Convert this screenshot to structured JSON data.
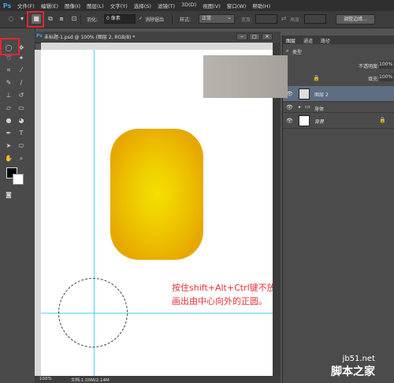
{
  "app": {
    "logo": "Ps"
  },
  "menu": [
    "文件(F)",
    "编辑(E)",
    "图像(I)",
    "图层(L)",
    "文字(Y)",
    "选择(S)",
    "滤镜(T)",
    "3D(D)",
    "视图(V)",
    "窗口(W)",
    "帮助(H)"
  ],
  "options": {
    "feather_label": "羽化:",
    "feather_value": "0 像素",
    "antialias_label": "消除锯齿",
    "style_label": "样式:",
    "style_value": "正常",
    "width_label": "宽度:",
    "height_label": "高度:",
    "refine_edge": "调整边缘..."
  },
  "document": {
    "tab_title": "未标题-1.psd @ 100% (图层 2, RGB/8) *",
    "zoom": "100%",
    "doc_size": "文档:1.00M/2.14M"
  },
  "annotation": {
    "line1": "按住shift+Alt+Ctrl键不放，",
    "line2": "画出由中心向外的正圆。"
  },
  "layers_panel": {
    "tabs": [
      "图层",
      "通道",
      "路径"
    ],
    "kind_filter": "类型",
    "opacity_label": "不透明度:",
    "opacity_value": "100%",
    "fill_label": "填充:",
    "fill_value": "100%",
    "layers": [
      {
        "name": "图层 2",
        "selected": true
      },
      {
        "name": "身体",
        "group": true
      },
      {
        "name": "背景",
        "locked": true
      }
    ]
  },
  "watermark": {
    "site": "jb51.net",
    "name": "脚本之家"
  },
  "colors": {
    "accent_red": "#e0282e",
    "guide": "#58d4ee",
    "annotation": "#e8303a",
    "shape_center": "#f3e000",
    "shape_edge": "#e6a800"
  }
}
